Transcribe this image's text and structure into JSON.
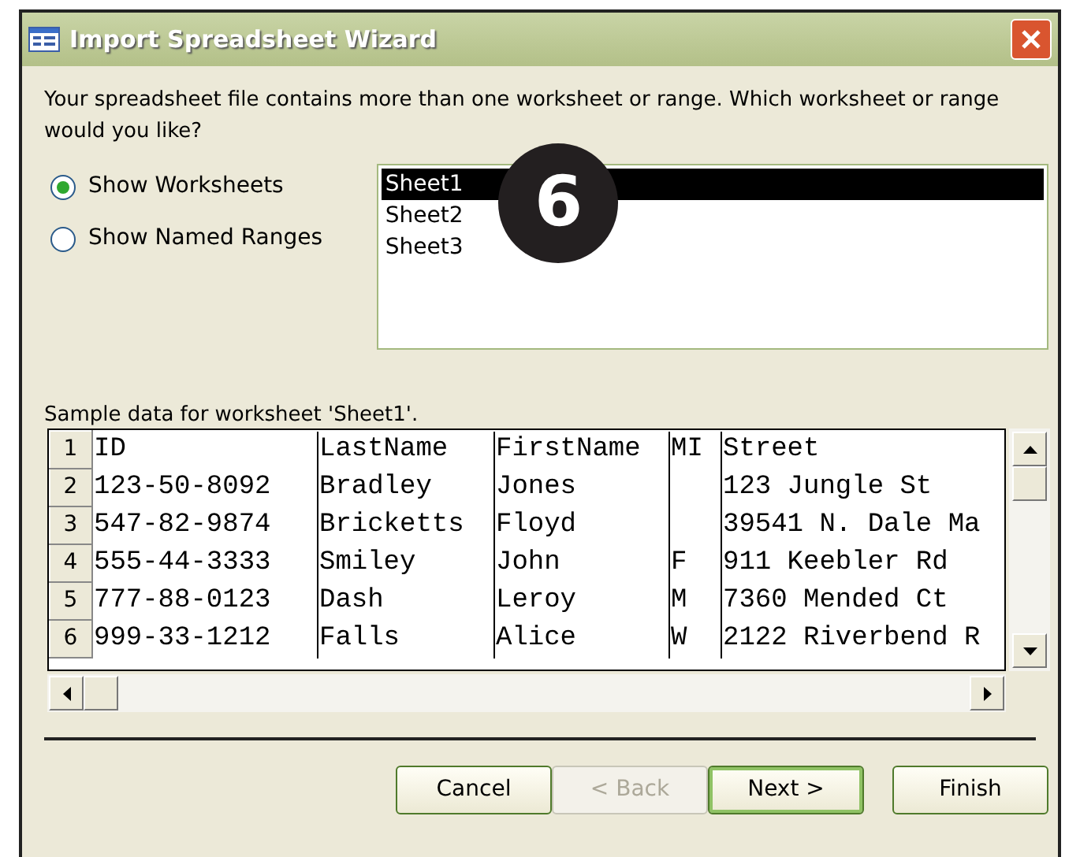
{
  "window": {
    "title": "Import Spreadsheet Wizard"
  },
  "prompt": "Your spreadsheet file contains more than one worksheet or range. Which worksheet or range would you like?",
  "options": [
    {
      "label": "Show Worksheets",
      "selected": true
    },
    {
      "label": "Show Named Ranges",
      "selected": false
    }
  ],
  "sheets": [
    {
      "label": "Sheet1",
      "selected": true
    },
    {
      "label": "Sheet2",
      "selected": false
    },
    {
      "label": "Sheet3",
      "selected": false
    }
  ],
  "callout": "6",
  "sample_caption": "Sample data for worksheet 'Sheet1'.",
  "table": {
    "rows": [
      {
        "number": "1",
        "cells": [
          "ID",
          "LastName",
          "FirstName",
          "MI",
          "Street"
        ]
      },
      {
        "number": "2",
        "cells": [
          "123-50-8092",
          "Bradley",
          "Jones",
          "",
          "123 Jungle St"
        ]
      },
      {
        "number": "3",
        "cells": [
          "547-82-9874",
          "Bricketts",
          "Floyd",
          "",
          "39541 N. Dale Ma"
        ]
      },
      {
        "number": "4",
        "cells": [
          "555-44-3333",
          "Smiley",
          "John",
          "F",
          "911 Keebler Rd"
        ]
      },
      {
        "number": "5",
        "cells": [
          "777-88-0123",
          "Dash",
          "Leroy",
          "M",
          "7360 Mended Ct"
        ]
      },
      {
        "number": "6",
        "cells": [
          "999-33-1212",
          "Falls",
          "Alice",
          "W",
          "2122 Riverbend R"
        ]
      }
    ]
  },
  "buttons": [
    {
      "label": "Cancel",
      "disabled": false,
      "default": false
    },
    {
      "label": "< Back",
      "disabled": true,
      "default": false
    },
    {
      "label": "Next >",
      "disabled": false,
      "default": true
    },
    {
      "label": "Finish",
      "disabled": false,
      "default": false
    }
  ]
}
